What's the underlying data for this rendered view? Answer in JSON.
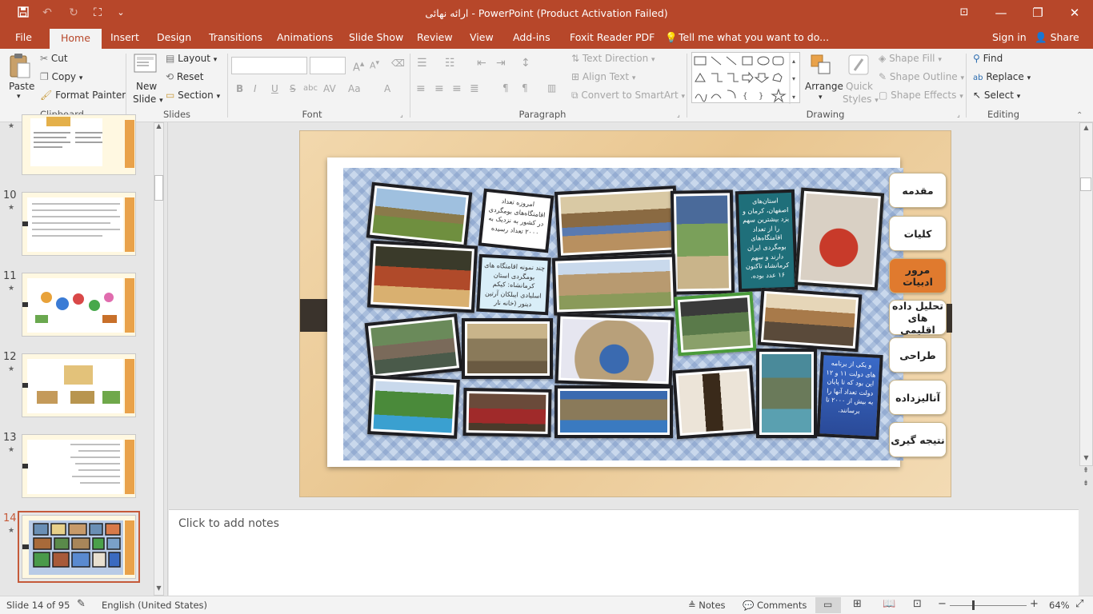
{
  "window": {
    "title": "ارائه نهائی - PowerPoint (Product Activation Failed)",
    "controls": {
      "restore_ribbon": "⊡",
      "minimize": "—",
      "maximize": "❐",
      "close": "✕"
    }
  },
  "quick_access": {
    "save": "save-icon",
    "undo": "undo-icon",
    "redo": "redo-icon",
    "present": "present-icon",
    "customize": "customize-icon"
  },
  "tabs": [
    "File",
    "Home",
    "Insert",
    "Design",
    "Transitions",
    "Animations",
    "Slide Show",
    "Review",
    "View",
    "Add-ins",
    "Foxit Reader PDF"
  ],
  "active_tab": "Home",
  "tell_me": "Tell me what you want to do...",
  "sign_in": "Sign in",
  "share": "Share",
  "ribbon": {
    "clipboard": {
      "paste": "Paste",
      "cut": "Cut",
      "copy": "Copy",
      "format_painter": "Format Painter",
      "group": "Clipboard"
    },
    "slides": {
      "new_slide_1": "New",
      "new_slide_2": "Slide",
      "layout": "Layout",
      "reset": "Reset",
      "section": "Section",
      "group": "Slides"
    },
    "font": {
      "group": "Font",
      "bold": "B",
      "italic": "I",
      "underline": "U",
      "strike": "S",
      "shadow": "abc",
      "spacing": "AV",
      "case": "Aa",
      "color": "A"
    },
    "paragraph": {
      "group": "Paragraph",
      "text_direction": "Text Direction",
      "align_text": "Align Text",
      "smartart": "Convert to SmartArt"
    },
    "drawing": {
      "group": "Drawing",
      "arrange": "Arrange",
      "quick_styles_1": "Quick",
      "quick_styles_2": "Styles",
      "shape_fill": "Shape Fill",
      "shape_outline": "Shape Outline",
      "shape_effects": "Shape Effects"
    },
    "editing": {
      "group": "Editing",
      "find": "Find",
      "replace": "Replace",
      "select": "Select"
    }
  },
  "thumbnails": [
    {
      "number": "",
      "star": "★"
    },
    {
      "number": "10",
      "star": "★"
    },
    {
      "number": "11",
      "star": "★"
    },
    {
      "number": "12",
      "star": "★"
    },
    {
      "number": "13",
      "star": "★"
    },
    {
      "number": "14",
      "star": "★"
    }
  ],
  "slide": {
    "text_box_1": "امروزه تعداد اقامتگاه‌های بومگردی در کشور به نزدیک به ۲۰۰۰ تعداد رسیده",
    "text_box_2": "چند نمونه اقامتگاه های بومگردی استان کرمانشاه: کیکم اسلیادی ایبلکان آرتین دینور (خانه نار ساسانکس) هورامان: زوال و ...",
    "text_box_3": "استان‌های اصفهان، کرمان و یزد بیشترین سهم را از تعداد اقامتگاه‌های بومگردی ایران دارند و سهم کرمانشاه تاکنون ۱۶ عدد بوده.",
    "text_box_4": "و یکی از برنامه های دولت ۱۱ و ۱۲ این بود که تا پایان دولت تعداد آنها را به بیش از ۲۰۰۰ تا برسانند.",
    "nav": [
      "مقدمه",
      "کلیات",
      "مرور ادبیات",
      "تحلیل داده های اقلیمی",
      "طراحی",
      "آنالیزداده",
      "نتیجه گیری"
    ],
    "nav_active": "مرور ادبیات"
  },
  "notes_placeholder": "Click to add notes",
  "status": {
    "slide_info": "Slide 14 of 95",
    "language": "English (United States)",
    "notes": "Notes",
    "comments": "Comments",
    "zoom": "64%",
    "zoom_level": 0.64
  },
  "colors": {
    "accent": "#b7472a",
    "nav_active": "#e07a2e",
    "nav_tab_dark": "#3a332c"
  }
}
